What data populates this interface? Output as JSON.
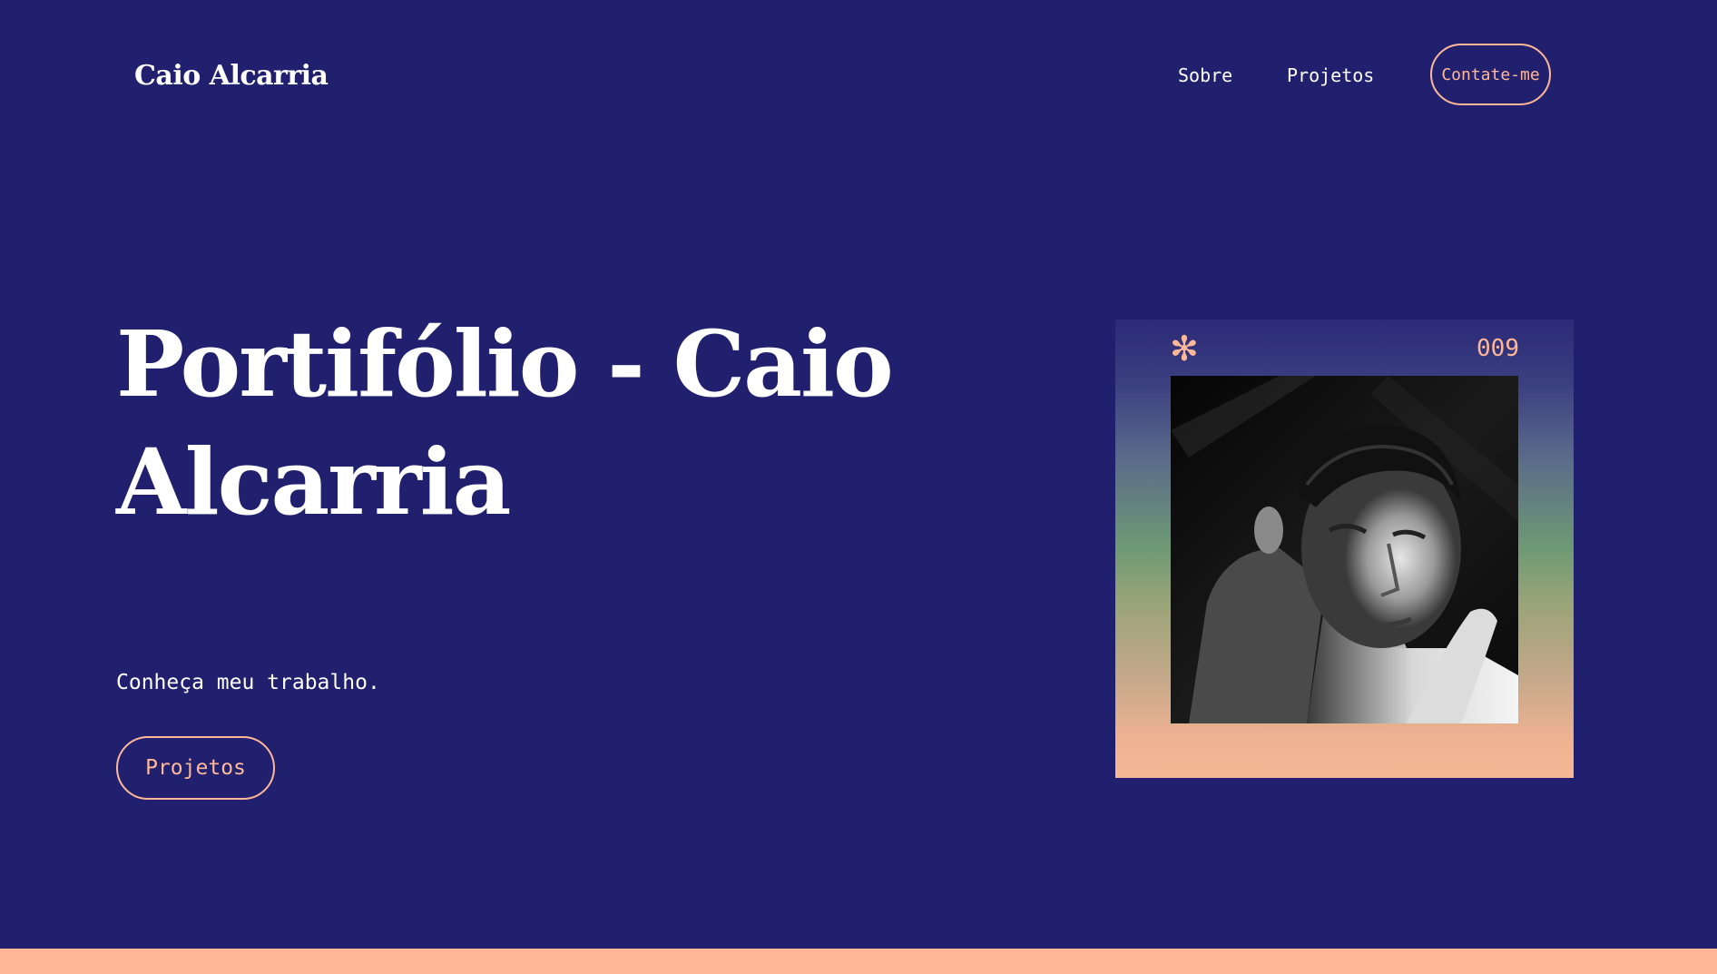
{
  "header": {
    "brand": "Caio Alcarria",
    "nav": [
      {
        "label": "Sobre"
      },
      {
        "label": "Projetos"
      }
    ],
    "contact_label": "Contate-me"
  },
  "hero": {
    "title": "Portifólio - Caio Alcarria",
    "subtitle": "Conheça meu trabalho.",
    "cta_label": "Projetos"
  },
  "card": {
    "number": "009",
    "icon": "asterisk-icon"
  },
  "colors": {
    "background": "#20206f",
    "accent": "#ffb897",
    "text": "#ffffff"
  }
}
